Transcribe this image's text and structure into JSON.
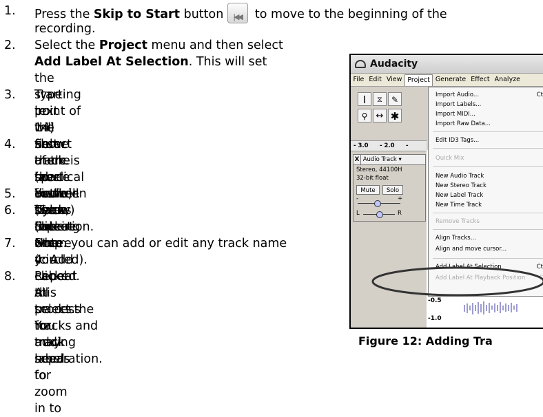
{
  "instructions": {
    "steps": [
      {
        "num": "1.",
        "pre": "Press the ",
        "bold": "Skip to Start",
        "post": " button",
        "post2": " to move to the beginning of the",
        "line2": "recording."
      },
      {
        "num": "2.",
        "line1": "Select the ",
        "bold1": "Project",
        "line1b": " menu and then select",
        "bold2": "Add Label At Selection",
        "line2b": ".  This will set",
        "line3": "the starting point of the first track."
      },
      {
        "num": "3.",
        "line1": "Type in the name of the first track, the",
        "line2": "text will show at the label marker. (See",
        "line3": "14)"
      },
      {
        "num": "4.",
        "line1": "Select the space between tracks (where",
        "line2": "there is no audio) by clicking once.",
        "line3": "(vertical circle below)"
      },
      {
        "num": "5.",
        "line1": "You will see a line where you clicked."
      },
      {
        "num": "6.",
        "line1": "Then repeat Step 4: Add Label At",
        "line2": "Selection."
      },
      {
        "num": "7.",
        "line1": "Note: you can add or edit any track name",
        "line2": "(circled)."
      },
      {
        "num": "8.",
        "line1": "Repeat this process for adding labels for",
        "line2": "all tracks.  You may need to zoom in to",
        "line3": "select the tracks and track separation."
      }
    ]
  },
  "skip_button": {
    "icon": "skip-to-start-icon",
    "glyph": "|◀◀"
  },
  "screenshot": {
    "window_title": "Audacity",
    "menubar": [
      "File",
      "Edit",
      "View",
      "Project",
      "Generate",
      "Effect",
      "Analyze"
    ],
    "active_menu": "Project",
    "ruler": [
      "- 3.0",
      "- 2.0",
      "-"
    ],
    "track": {
      "name": "Audio Track",
      "close": "X",
      "info1": "Stereo, 44100H",
      "info2": "32-bit float",
      "mute": "Mute",
      "solo": "Solo",
      "pan_left": "L",
      "pan_right": "R",
      "gain_minus": "-",
      "gain_plus": "+"
    },
    "project_menu": [
      {
        "label": "Import Audio...",
        "shortcut": "Ct",
        "enabled": true
      },
      {
        "label": "Import Labels...",
        "enabled": true
      },
      {
        "label": "Import MIDI...",
        "enabled": true
      },
      {
        "label": "Import Raw Data...",
        "enabled": true
      },
      {
        "label": "Edit ID3 Tags...",
        "enabled": true
      },
      {
        "label": "Quick Mix",
        "enabled": false
      },
      {
        "label": "New Audio Track",
        "enabled": true
      },
      {
        "label": "New Stereo Track",
        "enabled": true
      },
      {
        "label": "New Label Track",
        "enabled": true
      },
      {
        "label": "New Time Track",
        "enabled": true
      },
      {
        "label": "Remove Tracks",
        "enabled": false
      },
      {
        "label": "Align Tracks...",
        "enabled": true
      },
      {
        "label": "Align and move cursor...",
        "enabled": true
      },
      {
        "label": "Add Label At Selection",
        "shortcut": "Ct",
        "enabled": true
      },
      {
        "label": "Add Label At Playback Position",
        "shortcut": "C",
        "enabled": false
      }
    ],
    "scale_values": [
      "-0.5",
      "-1.0"
    ]
  },
  "caption": "Figure 12: Adding Tra"
}
